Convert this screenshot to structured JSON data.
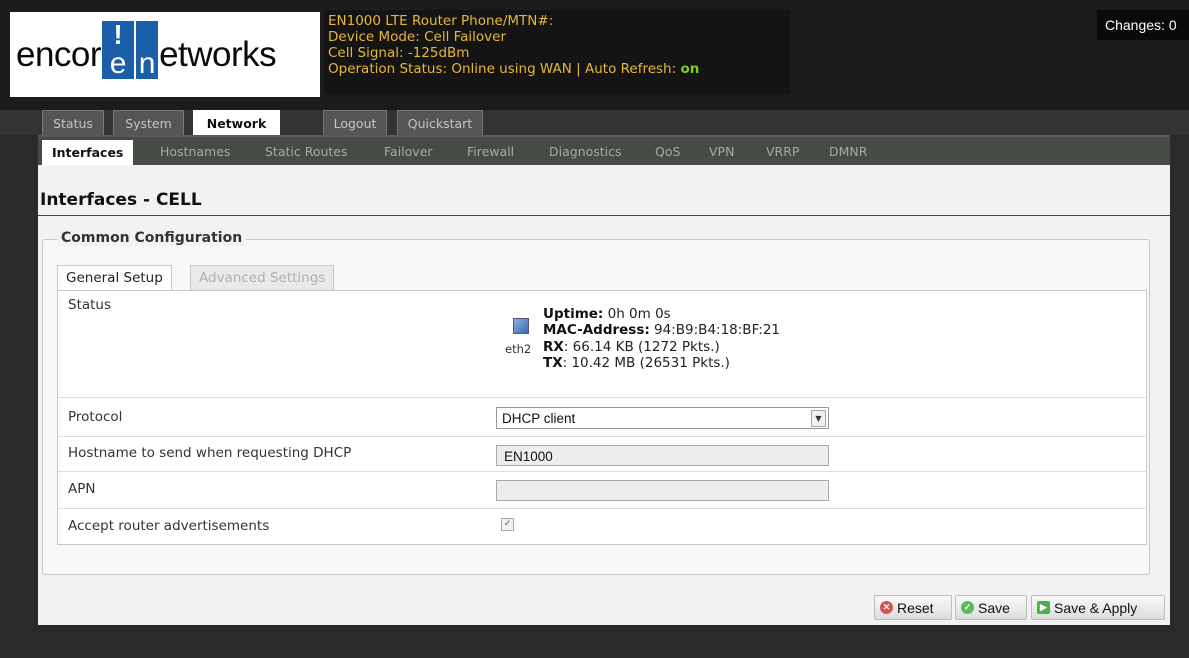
{
  "brand": {
    "logo_prefix": "encor",
    "logo_box_letter": "e",
    "logo_box_mark": "!",
    "logo_suffix": "etworks",
    "logo_n": "n"
  },
  "device": {
    "line1": "EN1000 LTE Router Phone/MTN#:",
    "line2": "Device Mode: Cell Failover",
    "line3": "Cell Signal: -125dBm",
    "line4_prefix": "Operation Status: Online using WAN | Auto Refresh: ",
    "auto_refresh": "on"
  },
  "changes": {
    "label": "Changes: 0"
  },
  "top_tabs": [
    "Status",
    "System",
    "Network",
    "Logout",
    "Quickstart"
  ],
  "sub_tabs": [
    "Interfaces",
    "Hostnames",
    "Static Routes",
    "Failover",
    "Firewall",
    "Diagnostics",
    "QoS",
    "VPN",
    "VRRP",
    "DMNR"
  ],
  "page": {
    "title": "Interfaces - CELL",
    "section": "Common Configuration"
  },
  "config_tabs": [
    "General Setup",
    "Advanced Settings"
  ],
  "status": {
    "label": "Status",
    "interface": "eth2",
    "uptime_label": "Uptime:",
    "uptime": " 0h 0m 0s",
    "mac_label": "MAC-Address:",
    "mac": " 94:B9:B4:18:BF:21",
    "rx_label": "RX",
    "rx": ": 66.14 KB (1272 Pkts.)",
    "tx_label": "TX",
    "tx": ": 10.42 MB (26531 Pkts.)"
  },
  "fields": {
    "protocol": {
      "label": "Protocol",
      "value": "DHCP client"
    },
    "hostname": {
      "label": "Hostname to send when requesting DHCP",
      "value": "EN1000"
    },
    "apn": {
      "label": "APN",
      "value": ""
    },
    "accept_ra": {
      "label": "Accept router advertisements",
      "checked": true
    }
  },
  "buttons": {
    "reset": "Reset",
    "save": "Save",
    "save_apply": "Save & Apply"
  },
  "colors": {
    "accent_yellow": "#e8b83c",
    "on_green": "#7fd11b",
    "logo_blue": "#1a5fa8",
    "reset_red": "#d9534f",
    "save_green": "#5cb85c"
  },
  "icons": {
    "interface": "network-port-icon",
    "reset": "reset-x-icon",
    "save": "save-check-icon",
    "save_apply": "save-apply-icon"
  }
}
